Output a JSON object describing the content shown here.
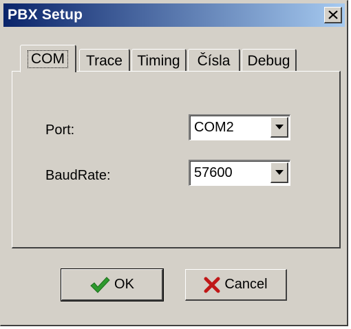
{
  "window": {
    "title": "PBX Setup"
  },
  "tabs": [
    {
      "label": "COM",
      "active": true
    },
    {
      "label": "Trace",
      "active": false
    },
    {
      "label": "Timing",
      "active": false
    },
    {
      "label": "Čísla",
      "active": false
    },
    {
      "label": "Debug",
      "active": false
    }
  ],
  "com": {
    "port_label": "Port:",
    "port_value": "COM2",
    "baudrate_label": "BaudRate:",
    "baudrate_value": "57600"
  },
  "buttons": {
    "ok_label": "OK",
    "cancel_label": "Cancel"
  },
  "colors": {
    "title_gradient_start": "#0a246a",
    "title_gradient_end": "#a6caf0",
    "ok_check": "#2e9a2e",
    "cancel_x": "#c01818"
  },
  "icons": {
    "ok": "checkmark-icon",
    "cancel": "x-icon",
    "close": "close-icon",
    "dropdown": "chevron-down-icon"
  }
}
